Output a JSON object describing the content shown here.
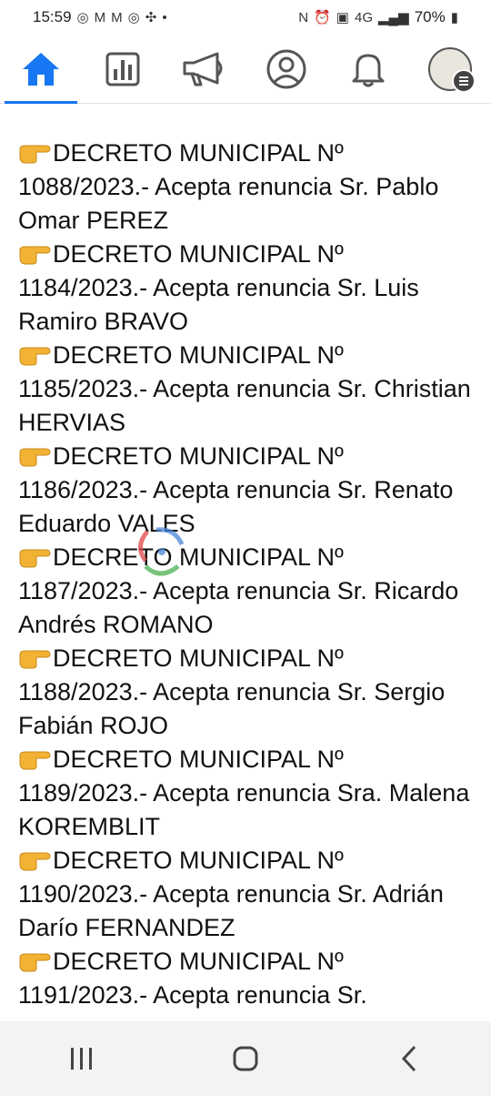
{
  "status_bar": {
    "time": "15:59",
    "battery": "70%"
  },
  "nav": {
    "tabs": [
      {
        "name": "home",
        "icon": "home-icon",
        "active": true
      },
      {
        "name": "dashboard",
        "icon": "bar-chart-icon"
      },
      {
        "name": "ads",
        "icon": "megaphone-icon"
      },
      {
        "name": "profile",
        "icon": "profile-icon"
      },
      {
        "name": "notifications",
        "icon": "bell-icon"
      },
      {
        "name": "menu",
        "icon": "avatar-menu-icon"
      }
    ],
    "accent": "#1877f2"
  },
  "post": {
    "decrees": [
      {
        "line1": "DECRETO MUNICIPAL Nº",
        "line2": "1088/2023.- Acepta renuncia Sr. Pablo Omar PEREZ"
      },
      {
        "line1": "DECRETO MUNICIPAL Nº",
        "line2": "1184/2023.- Acepta renuncia Sr. Luis Ramiro BRAVO"
      },
      {
        "line1": "DECRETO MUNICIPAL Nº",
        "line2": "1185/2023.- Acepta renuncia Sr. Christian HERVIAS"
      },
      {
        "line1": "DECRETO MUNICIPAL Nº",
        "line2": "1186/2023.- Acepta renuncia Sr. Renato Eduardo VALES"
      },
      {
        "line1": "DECRETO MUNICIPAL Nº",
        "line2": "1187/2023.- Acepta renuncia Sr. Ricardo Andrés ROMANO"
      },
      {
        "line1": "DECRETO MUNICIPAL Nº",
        "line2": "1188/2023.- Acepta renuncia Sr. Sergio Fabián ROJO"
      },
      {
        "line1": "DECRETO MUNICIPAL Nº",
        "line2": "1189/2023.- Acepta renuncia Sra. Malena KOREMBLIT"
      },
      {
        "line1": "DECRETO MUNICIPAL Nº",
        "line2": "1190/2023.- Acepta renuncia Sr. Adrián Darío FERNANDEZ"
      },
      {
        "line1": "DECRETO MUNICIPAL Nº",
        "line2": "1191/2023.- Acepta renuncia Sr."
      }
    ]
  },
  "system_nav": {
    "buttons": [
      "recent-apps-icon",
      "home-button-icon",
      "back-icon"
    ]
  }
}
